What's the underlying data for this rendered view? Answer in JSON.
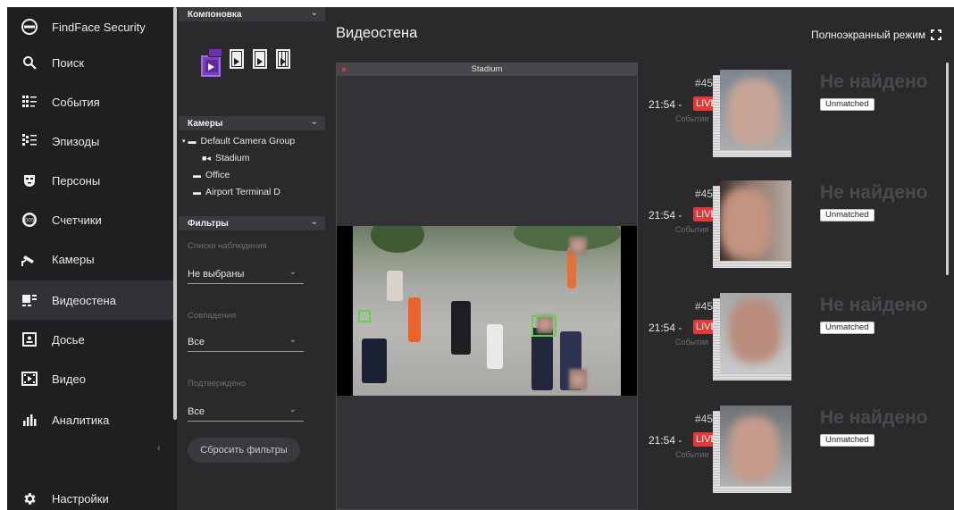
{
  "nav": {
    "brand": "FindFace Security",
    "items": [
      {
        "label": "Поиск",
        "icon": "search-icon"
      },
      {
        "label": "События",
        "icon": "events-icon"
      },
      {
        "label": "Эпизоды",
        "icon": "episodes-icon"
      },
      {
        "label": "Персоны",
        "icon": "persons-icon"
      },
      {
        "label": "Счетчики",
        "icon": "counters-icon"
      },
      {
        "label": "Камеры",
        "icon": "camera-icon"
      },
      {
        "label": "Видеостена",
        "icon": "videowall-icon"
      },
      {
        "label": "Досье",
        "icon": "dossier-icon"
      },
      {
        "label": "Видео",
        "icon": "video-icon"
      },
      {
        "label": "Аналитика",
        "icon": "analytics-icon"
      }
    ],
    "active_item": "Видеостена",
    "settings": "Настройки",
    "collapse_glyph": "‹"
  },
  "panel": {
    "layout_header": "Компоновка",
    "cameras_header": "Камеры",
    "camera_tree": {
      "group": "Default Camera Group",
      "camera": "Stadium",
      "others": [
        "Office",
        "Airport Terminal D"
      ]
    },
    "filters_header": "Фильтры",
    "filters": [
      {
        "label": "Списки наблюдения",
        "value": "Не выбраны"
      },
      {
        "label": "Совпадения",
        "value": "Все"
      },
      {
        "label": "Подтверждено",
        "value": "Все"
      }
    ],
    "reset_label": "Сбросить фильтры"
  },
  "main": {
    "title": "Видеостена",
    "fullscreen_label": "Полноэкранный режим",
    "tile_camera": "Stadium"
  },
  "events": [
    {
      "id": "#45",
      "time": "21:54 -",
      "live": "LIVE",
      "sub": "События",
      "not_found": "Не найдено",
      "badge": "Unmatched"
    },
    {
      "id": "#45",
      "time": "21:54 -",
      "live": "LIVE",
      "sub": "События",
      "not_found": "Не найдено",
      "badge": "Unmatched"
    },
    {
      "id": "#45",
      "time": "21:54 -",
      "live": "LIVE",
      "sub": "События",
      "not_found": "Не найдено",
      "badge": "Unmatched"
    },
    {
      "id": "#45",
      "time": "21:54 -",
      "live": "LIVE",
      "sub": "События",
      "not_found": "Не найдено",
      "badge": "Unmatched"
    }
  ],
  "colors": {
    "accent": "#7a3fc4",
    "live": "#e53935",
    "bg": "#2a2a2d",
    "nav_bg": "#1f1f21"
  }
}
